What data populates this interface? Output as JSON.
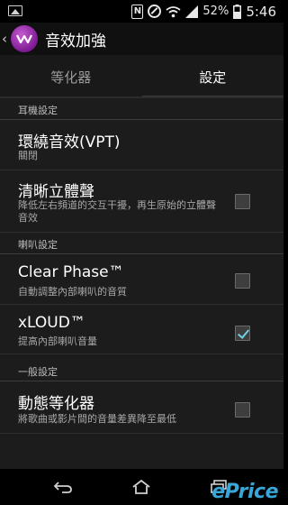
{
  "status_bar": {
    "battery": "52%",
    "time": "5:46",
    "icons": [
      "image-icon",
      "nfc-icon",
      "blocked-icon",
      "wifi-icon",
      "signal-icon",
      "battery-icon"
    ]
  },
  "app_bar": {
    "title": "音效加強",
    "icon": "walkman-icon"
  },
  "tabs": [
    {
      "label": "等化器",
      "active": false
    },
    {
      "label": "設定",
      "active": true
    }
  ],
  "settings": {
    "headphone_section": "耳機設定",
    "vpt": {
      "title": "環繞音效(VPT)",
      "summary": "關閉"
    },
    "clear_voice": {
      "title": "清晰立體聲",
      "summary": "降低左右頻道的交互干擾，再生原始的立體聲音效",
      "checked": false
    },
    "speaker_section": "喇叭設定",
    "clear_phase": {
      "title": "Clear Phase™",
      "summary": "自動調整內部喇叭的音質",
      "checked": false
    },
    "xloud": {
      "title": "xLOUD™",
      "summary": "提高內部喇叭音量",
      "checked": true
    },
    "general_section": "一般設定",
    "dynamic_eq": {
      "title": "動態等化器",
      "summary": "將歌曲或影片間的音量差異降至最低",
      "checked": false
    }
  },
  "watermark": "ePrice",
  "colors": {
    "accent": "#6fd1e4",
    "app_icon": "#9b2bb0",
    "watermark_blue": "#39a6d8",
    "watermark_yellow": "#f3c419"
  }
}
